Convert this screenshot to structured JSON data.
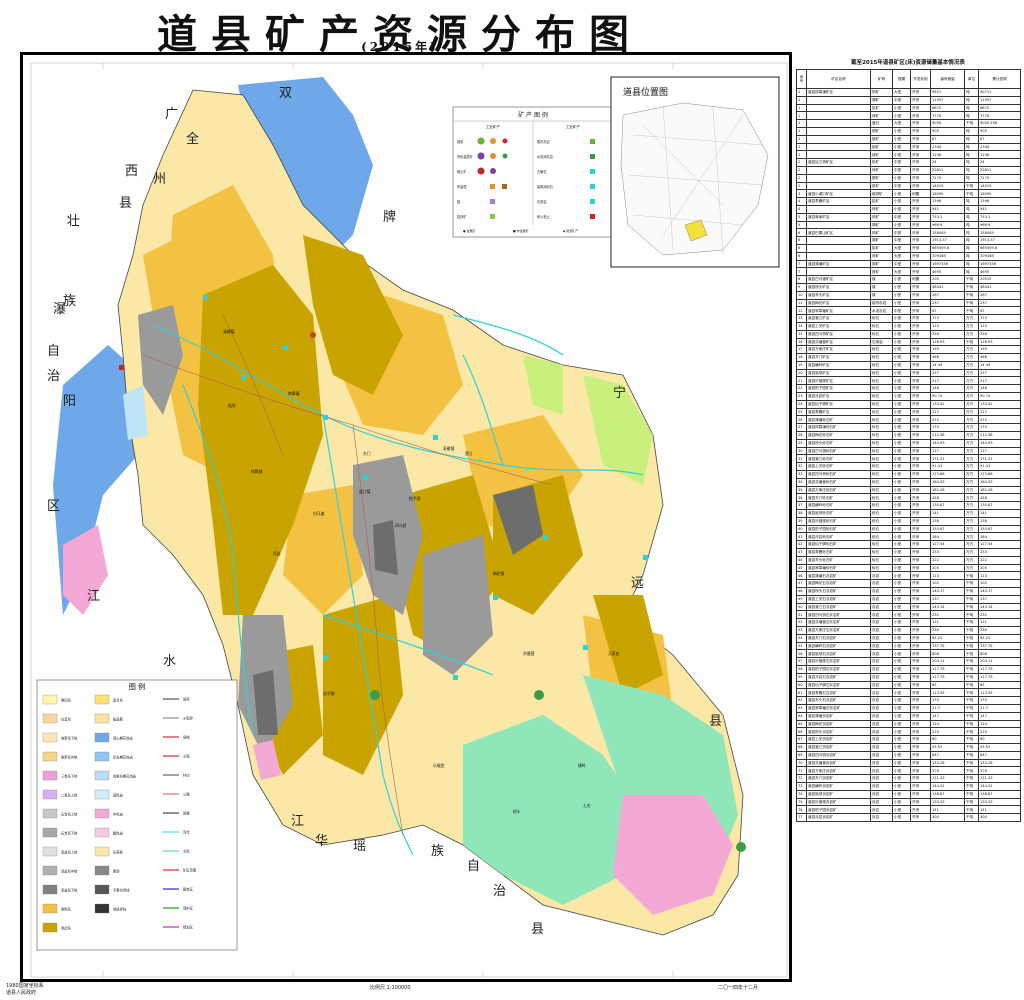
{
  "title": "道县矿产资源分布图",
  "subtitle": "(2015年)",
  "inset": {
    "title": "道县位置图"
  },
  "mineral_legend": {
    "title": "矿 产 图 例",
    "energy_header": "工业矿产",
    "nonmetal_header": "工业矿产",
    "size_labels": [
      "大型",
      "中型",
      "小型"
    ],
    "rows_left": [
      "煤炭",
      "有色金属矿",
      "稀土矿",
      "贵金属",
      "钼",
      "铅锌矿"
    ],
    "rows_right": [
      "熔剂灰岩",
      "水泥用灰岩",
      "方解石",
      "建筑用砂石",
      "石英岩",
      "耐火粘土"
    ],
    "footer": [
      "● 金属矿",
      "■ 非金属矿",
      "◆ 能源矿产"
    ]
  },
  "geo_legend": {
    "title": "图 例",
    "left_items": [
      "第四系",
      "白垩系",
      "侏罗系下统",
      "侏罗系中统",
      "三叠系下统",
      "二叠系上统",
      "石炭系上统",
      "石炭系下统",
      "泥盆系上统",
      "泥盆系中统",
      "泥盆系下统",
      "奥陶系",
      "寒武系",
      "震旦系",
      "板溪群",
      "燕山期花岗岩",
      "印支期花岗岩",
      "加里东期花岗岩",
      "基性岩",
      "中性岩",
      "酸性岩",
      "石英脉",
      "断层",
      "不整合界线",
      "地质界线"
    ],
    "right_items": [
      "县界",
      "乡镇界",
      "县城",
      "乡镇",
      "村庄",
      "公路",
      "铁路",
      "河流",
      "水库",
      "矿区范围",
      "勘查区",
      "保护区",
      "规划区"
    ]
  },
  "labels": {
    "regions": [
      "广",
      "西",
      "全",
      "州",
      "县",
      "壮",
      "族",
      "瀑",
      "自",
      "治",
      "阳",
      "区",
      "江",
      "水",
      "双",
      "牌",
      "宁",
      "远",
      "县",
      "江",
      "华",
      "瑶",
      "族",
      "自",
      "治",
      "县"
    ],
    "towns": [
      "道江镇",
      "清塘镇",
      "祥霖铺",
      "梅花镇",
      "寿雁镇",
      "白马渡",
      "仙子脚",
      "营江",
      "四马桥",
      "审章塘",
      "洪塘营",
      "万家庄",
      "东门",
      "横岭",
      "蚣坝",
      "乐福堂",
      "桥头",
      "上关",
      "柑子园",
      "月岩"
    ]
  },
  "bottom": {
    "left1": "1980国家坐标系",
    "left2": "道县人民政府",
    "scale": "比例尺 1:100000",
    "right": "二〇一四年十二月"
  },
  "table": {
    "title": "截至2015年道县矿区(床)资源储量基本情况表",
    "headers": [
      "序号",
      "矿区名称",
      "矿种",
      "规模",
      "开发利用",
      "保有储量",
      "单位",
      "累计查明"
    ],
    "rows": [
      [
        "1",
        "道县祥霖铺矿区",
        "钨矿",
        "大型",
        "开采",
        "9821",
        "吨",
        "40711"
      ],
      [
        "1",
        "",
        "锡矿",
        "中型",
        "开采",
        "11597",
        "吨",
        "11597"
      ],
      [
        "1",
        "",
        "铅矿",
        "小型",
        "开采",
        "8872",
        "吨",
        "8872"
      ],
      [
        "1",
        "",
        "锌矿",
        "小型",
        "开采",
        "7770",
        "吨",
        "7770"
      ],
      [
        "1",
        "",
        "萤石",
        "大型",
        "开采",
        "5050",
        "千吨",
        "5050.596"
      ],
      [
        "1",
        "",
        "铜矿",
        "小型",
        "开采",
        "905",
        "吨",
        "905"
      ],
      [
        "1",
        "",
        "铍矿",
        "小型",
        "开采",
        "67",
        "吨",
        "67"
      ],
      [
        "1",
        "",
        "钼矿",
        "小型",
        "开采",
        "2344",
        "吨",
        "2344"
      ],
      [
        "1",
        "",
        "铋矿",
        "小型",
        "开采",
        "1236",
        "吨",
        "1236"
      ],
      [
        "2",
        "道县后江桥矿区",
        "铅矿",
        "中型",
        "开采",
        "24",
        "吨",
        "24"
      ],
      [
        "2",
        "",
        "锌矿",
        "中型",
        "开采",
        "22811",
        "吨",
        "22811"
      ],
      [
        "2",
        "",
        "银矿",
        "小型",
        "开采",
        "7170",
        "吨",
        "7170"
      ],
      [
        "2",
        "",
        "铁矿",
        "中型",
        "开采",
        "14019",
        "千吨",
        "14019"
      ],
      [
        "3",
        "道县小源口矿区",
        "硫铁矿",
        "小型",
        "闲置",
        "16095",
        "千吨",
        "16095"
      ],
      [
        "4",
        "道县寿雁矿区",
        "铅矿",
        "小型",
        "开采",
        "1396",
        "吨",
        "1396"
      ],
      [
        "4",
        "",
        "锌矿",
        "小型",
        "开采",
        "941",
        "吨",
        "941"
      ],
      [
        "5",
        "道县蒋家矿区",
        "钨矿",
        "中型",
        "开采",
        "753.1",
        "吨",
        "753.1"
      ],
      [
        "5",
        "",
        "锡矿",
        "小型",
        "开采",
        "966.9",
        "吨",
        "966.9"
      ],
      [
        "6",
        "道县巴果山矿区",
        "钨矿",
        "中型",
        "开采",
        "158449",
        "吨",
        "158449"
      ],
      [
        "6",
        "",
        "锡矿",
        "中型",
        "开采",
        "1913.37",
        "吨",
        "1913.37"
      ],
      [
        "6",
        "",
        "铅矿",
        "大型",
        "开采",
        "689359.6",
        "吨",
        "689359.6"
      ],
      [
        "6",
        "",
        "锌矿",
        "大型",
        "开采",
        "209358",
        "吨",
        "209358"
      ],
      [
        "7",
        "道县清塘矿区",
        "铜矿",
        "中型",
        "开采",
        "1697336",
        "吨",
        "1697336"
      ],
      [
        "7",
        "",
        "铁矿",
        "大型",
        "开采",
        "4695",
        "吨",
        "4695"
      ],
      [
        "8",
        "道县白马渡矿区",
        "煤",
        "小型",
        "闲置",
        "205",
        "千吨",
        "20515"
      ],
      [
        "9",
        "道县桥头矿区",
        "煤",
        "小型",
        "开采",
        "38441",
        "千吨",
        "38441"
      ],
      [
        "10",
        "道县车头矿区",
        "煤",
        "小型",
        "开采",
        "267",
        "千吨",
        "267"
      ],
      [
        "11",
        "道县梅花矿区",
        "熔剂灰岩",
        "小型",
        "开采",
        "237",
        "千吨",
        "237"
      ],
      [
        "12",
        "道县审章塘矿区",
        "水泥灰岩",
        "中型",
        "开采",
        "67",
        "千吨",
        "67"
      ],
      [
        "13",
        "道县营江矿区",
        "砂石",
        "小型",
        "开采",
        "173",
        "万方",
        "173"
      ],
      [
        "14",
        "道县上关矿区",
        "砂石",
        "小型",
        "开采",
        "110",
        "万方",
        "110"
      ],
      [
        "15",
        "道县四马桥矿区",
        "砂石",
        "小型",
        "开采",
        "256",
        "万方",
        "256"
      ],
      [
        "16",
        "道县洪塘营矿区",
        "石英岩",
        "小型",
        "开采",
        "118.93",
        "千吨",
        "118.93"
      ],
      [
        "17",
        "道县万家庄矿区",
        "砂石",
        "小型",
        "开采",
        "195",
        "万方",
        "195"
      ],
      [
        "18",
        "道县东门矿区",
        "砂石",
        "小型",
        "开采",
        "468",
        "万方",
        "468"
      ],
      [
        "19",
        "道县横岭矿区",
        "砂石",
        "小型",
        "开采",
        "14.44",
        "万方",
        "14.44"
      ],
      [
        "20",
        "道县蚣坝矿区",
        "砂石",
        "小型",
        "开采",
        "257",
        "万方",
        "257"
      ],
      [
        "21",
        "道县乐福堂矿区",
        "砂石",
        "小型",
        "开采",
        "217",
        "万方",
        "217"
      ],
      [
        "22",
        "道县柑子园矿区",
        "砂石",
        "小型",
        "开采",
        "148",
        "万方",
        "148"
      ],
      [
        "23",
        "道县月岩矿区",
        "砂石",
        "小型",
        "开采",
        "90.74",
        "万方",
        "90.74"
      ],
      [
        "24",
        "道县仙子脚矿区",
        "砂石",
        "小型",
        "开采",
        "133.41",
        "万方",
        "133.41"
      ],
      [
        "25",
        "道县寿雁矿区",
        "砂石",
        "小型",
        "开采",
        "227",
        "万方",
        "227"
      ],
      [
        "26",
        "道县清塘砂石矿",
        "砂石",
        "小型",
        "开采",
        "472",
        "万方",
        "472"
      ],
      [
        "27",
        "道县祥霖铺砂石矿",
        "砂石",
        "小型",
        "开采",
        "175",
        "万方",
        "175"
      ],
      [
        "28",
        "道县梅花砂石矿",
        "砂石",
        "小型",
        "开采",
        "212.38",
        "万方",
        "212.38"
      ],
      [
        "29",
        "道县桥头砂石矿",
        "砂石",
        "小型",
        "开采",
        "144.93",
        "万方",
        "144.93"
      ],
      [
        "30",
        "道县白马渡砂石矿",
        "砂石",
        "小型",
        "开采",
        "117",
        "万方",
        "117"
      ],
      [
        "31",
        "道县营江砂石矿",
        "砂石",
        "小型",
        "开采",
        "171.21",
        "万方",
        "171.21"
      ],
      [
        "32",
        "道县上关砂石矿",
        "砂石",
        "小型",
        "开采",
        "91.41",
        "万方",
        "91.41"
      ],
      [
        "33",
        "道县四马桥砂石矿",
        "砂石",
        "小型",
        "开采",
        "173.86",
        "万方",
        "173.86"
      ],
      [
        "34",
        "道县洪塘营砂石矿",
        "砂石",
        "小型",
        "开采",
        "164.33",
        "万方",
        "164.33"
      ],
      [
        "35",
        "道县万家庄砂石矿",
        "砂石",
        "小型",
        "开采",
        "182.28",
        "万方",
        "182.28"
      ],
      [
        "36",
        "道县东门砂石矿",
        "砂石",
        "小型",
        "开采",
        "458",
        "万方",
        "458"
      ],
      [
        "37",
        "道县横岭砂石矿",
        "砂石",
        "小型",
        "开采",
        "130.67",
        "万方",
        "130.67"
      ],
      [
        "38",
        "道县蚣坝砂石矿",
        "砂石",
        "小型",
        "开采",
        "141",
        "万方",
        "141"
      ],
      [
        "39",
        "道县乐福堂砂石矿",
        "砂石",
        "小型",
        "开采",
        "138",
        "万方",
        "138"
      ],
      [
        "40",
        "道县柑子园砂石矿",
        "砂石",
        "小型",
        "开采",
        "150.67",
        "万方",
        "150.67"
      ],
      [
        "41",
        "道县月岩砂石矿",
        "砂石",
        "小型",
        "开采",
        "184",
        "万方",
        "184"
      ],
      [
        "42",
        "道县仙子脚砂石矿",
        "砂石",
        "小型",
        "开采",
        "127.44",
        "万方",
        "127.44"
      ],
      [
        "43",
        "道县寿雁砂石矿",
        "砂石",
        "小型",
        "开采",
        "233",
        "万方",
        "233"
      ],
      [
        "44",
        "道县车头砂石矿",
        "砂石",
        "小型",
        "开采",
        "222",
        "万方",
        "222"
      ],
      [
        "45",
        "道县审章塘砂石矿",
        "砂石",
        "小型",
        "开采",
        "205",
        "万方",
        "205"
      ],
      [
        "46",
        "道县清塘石灰岩矿",
        "灰岩",
        "小型",
        "开采",
        "113",
        "千吨",
        "113"
      ],
      [
        "47",
        "道县梅花石灰岩矿",
        "灰岩",
        "小型",
        "开采",
        "102",
        "千吨",
        "102"
      ],
      [
        "48",
        "道县桥头石灰岩矿",
        "灰岩",
        "小型",
        "开采",
        "140.17",
        "千吨",
        "140.17"
      ],
      [
        "49",
        "道县上关石灰岩矿",
        "灰岩",
        "小型",
        "开采",
        "137",
        "千吨",
        "137"
      ],
      [
        "50",
        "道县营江石灰岩矿",
        "灰岩",
        "小型",
        "开采",
        "143.14",
        "千吨",
        "143.14"
      ],
      [
        "51",
        "道县四马桥石灰岩矿",
        "灰岩",
        "小型",
        "开采",
        "230",
        "千吨",
        "230"
      ],
      [
        "52",
        "道县洪塘营石灰岩矿",
        "灰岩",
        "小型",
        "开采",
        "111",
        "千吨",
        "111"
      ],
      [
        "53",
        "道县万家庄石灰岩矿",
        "灰岩",
        "小型",
        "开采",
        "230",
        "千吨",
        "230"
      ],
      [
        "54",
        "道县东门石灰岩矿",
        "灰岩",
        "小型",
        "开采",
        "85.22",
        "千吨",
        "85.22"
      ],
      [
        "55",
        "道县横岭石灰岩矿",
        "灰岩",
        "小型",
        "开采",
        "137.75",
        "千吨",
        "137.75"
      ],
      [
        "56",
        "道县蚣坝石灰岩矿",
        "灰岩",
        "小型",
        "开采",
        "806",
        "千吨",
        "806"
      ],
      [
        "57",
        "道县乐福堂石灰岩矿",
        "灰岩",
        "小型",
        "开采",
        "204.11",
        "千吨",
        "204.11"
      ],
      [
        "58",
        "道县柑子园石灰岩矿",
        "灰岩",
        "小型",
        "开采",
        "117.73",
        "千吨",
        "117.73"
      ],
      [
        "59",
        "道县月岩石灰岩矿",
        "灰岩",
        "小型",
        "开采",
        "117.73",
        "千吨",
        "117.73"
      ],
      [
        "60",
        "道县仙子脚石灰岩矿",
        "灰岩",
        "小型",
        "开采",
        "85",
        "千吨",
        "85"
      ],
      [
        "61",
        "道县寿雁石灰岩矿",
        "灰岩",
        "小型",
        "开采",
        "113.35",
        "千吨",
        "113.35"
      ],
      [
        "62",
        "道县车头石灰岩矿",
        "灰岩",
        "小型",
        "开采",
        "170",
        "千吨",
        "170"
      ],
      [
        "63",
        "道县审章塘石灰岩矿",
        "灰岩",
        "小型",
        "开采",
        "21.7",
        "千吨",
        "21.7"
      ],
      [
        "64",
        "道县清塘页岩矿",
        "页岩",
        "小型",
        "开采",
        "147",
        "千吨",
        "147"
      ],
      [
        "65",
        "道县梅花页岩矿",
        "页岩",
        "小型",
        "开采",
        "124",
        "千吨",
        "124"
      ],
      [
        "66",
        "道县桥头页岩矿",
        "页岩",
        "小型",
        "开采",
        "220",
        "千吨",
        "220"
      ],
      [
        "67",
        "道县上关页岩矿",
        "页岩",
        "小型",
        "开采",
        "60",
        "千吨",
        "60"
      ],
      [
        "68",
        "道县营江页岩矿",
        "页岩",
        "小型",
        "开采",
        "59.91",
        "千吨",
        "59.91"
      ],
      [
        "69",
        "道县四马桥页岩矿",
        "页岩",
        "小型",
        "开采",
        "847",
        "千吨",
        "847"
      ],
      [
        "70",
        "道县洪塘营页岩矿",
        "页岩",
        "小型",
        "开采",
        "133.28",
        "千吨",
        "133.28"
      ],
      [
        "71",
        "道县万家庄页岩矿",
        "页岩",
        "小型",
        "开采",
        "576",
        "千吨",
        "576"
      ],
      [
        "72",
        "道县东门页岩矿",
        "页岩",
        "小型",
        "开采",
        "171.33",
        "千吨",
        "171.33"
      ],
      [
        "73",
        "道县横岭页岩矿",
        "页岩",
        "小型",
        "开采",
        "144.31",
        "千吨",
        "144.31"
      ],
      [
        "74",
        "道县蚣坝页岩矿",
        "页岩",
        "小型",
        "开采",
        "138.67",
        "千吨",
        "138.67"
      ],
      [
        "75",
        "道县乐福堂页岩矿",
        "页岩",
        "小型",
        "开采",
        "133.33",
        "千吨",
        "133.33"
      ],
      [
        "76",
        "道县柑子园页岩矿",
        "页岩",
        "小型",
        "开采",
        "141",
        "千吨",
        "141"
      ],
      [
        "77",
        "道县月岩页岩矿",
        "页岩",
        "小型",
        "开采",
        "300",
        "千吨",
        "300"
      ]
    ]
  },
  "colors": {
    "water": "#6fa8e8",
    "pink": "#f4a8d6",
    "pale_yellow": "#fbe7a6",
    "yellow": "#f4c242",
    "olive": "#c9a400",
    "gray": "#9a9a9a",
    "dark_gray": "#6d6d6d",
    "green": "#8fe6b8",
    "lime": "#c9ef7d",
    "river": "#30d0d8"
  }
}
